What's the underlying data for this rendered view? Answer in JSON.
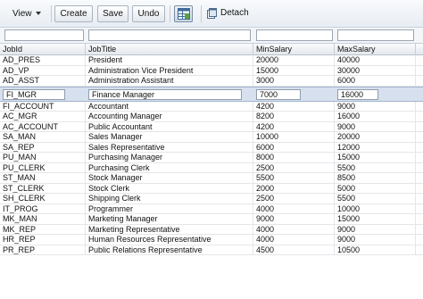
{
  "toolbar": {
    "view_label": "View",
    "create_label": "Create",
    "save_label": "Save",
    "undo_label": "Undo",
    "detach_label": "Detach"
  },
  "columns": [
    "JobId",
    "JobTitle",
    "MinSalary",
    "MaxSalary"
  ],
  "rows": [
    [
      "AD_PRES",
      "President",
      "20000",
      "40000"
    ],
    [
      "AD_VP",
      "Administration Vice President",
      "15000",
      "30000"
    ],
    [
      "AD_ASST",
      "Administration Assistant",
      "3000",
      "6000"
    ],
    [
      "FI_MGR",
      "Finance Manager",
      "7000",
      "16000"
    ],
    [
      "FI_ACCOUNT",
      "Accountant",
      "4200",
      "9000"
    ],
    [
      "AC_MGR",
      "Accounting Manager",
      "8200",
      "16000"
    ],
    [
      "AC_ACCOUNT",
      "Public Accountant",
      "4200",
      "9000"
    ],
    [
      "SA_MAN",
      "Sales Manager",
      "10000",
      "20000"
    ],
    [
      "SA_REP",
      "Sales Representative",
      "6000",
      "12000"
    ],
    [
      "PU_MAN",
      "Purchasing Manager",
      "8000",
      "15000"
    ],
    [
      "PU_CLERK",
      "Purchasing Clerk",
      "2500",
      "5500"
    ],
    [
      "ST_MAN",
      "Stock Manager",
      "5500",
      "8500"
    ],
    [
      "ST_CLERK",
      "Stock Clerk",
      "2000",
      "5000"
    ],
    [
      "SH_CLERK",
      "Shipping Clerk",
      "2500",
      "5500"
    ],
    [
      "IT_PROG",
      "Programmer",
      "4000",
      "10000"
    ],
    [
      "MK_MAN",
      "Marketing Manager",
      "9000",
      "15000"
    ],
    [
      "MK_REP",
      "Marketing Representative",
      "4000",
      "9000"
    ],
    [
      "HR_REP",
      "Human Resources Representative",
      "4000",
      "9000"
    ],
    [
      "PR_REP",
      "Public Relations Representative",
      "4500",
      "10500"
    ]
  ],
  "selected_row_index": 3,
  "colors": {
    "selected_row": "#d7e0ee",
    "toolbar_bg": "#e8edf3"
  },
  "icons": [
    "chevron-down-icon",
    "grid-view-icon",
    "detach-icon"
  ]
}
